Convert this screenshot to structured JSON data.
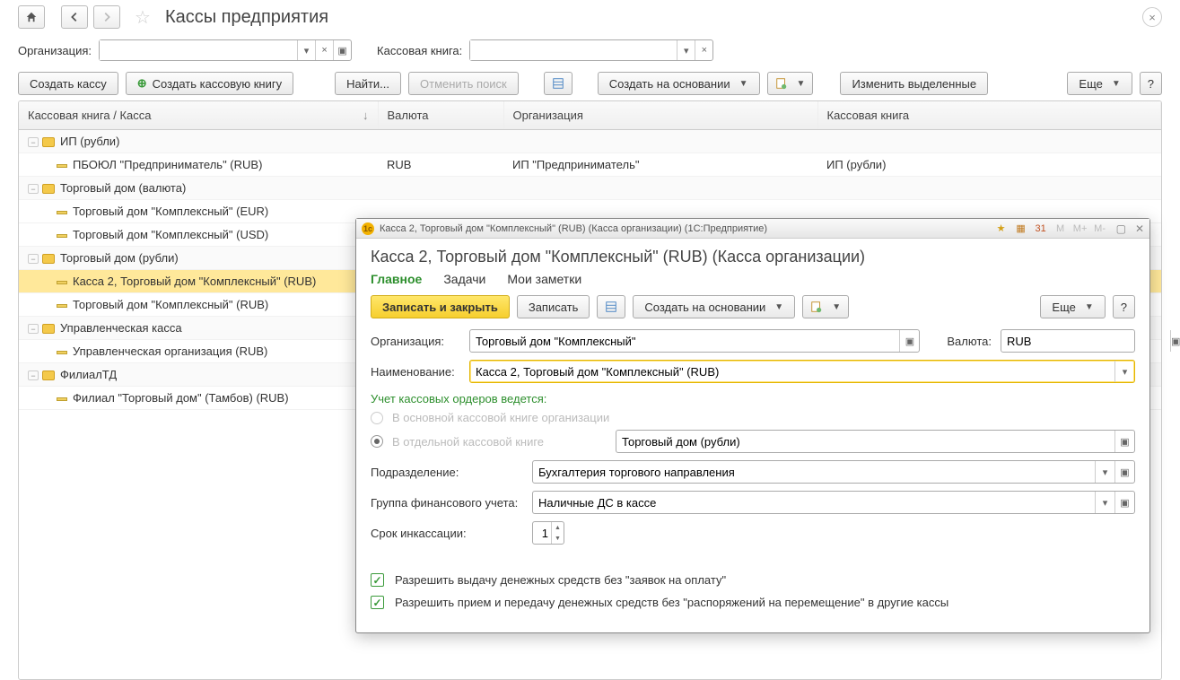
{
  "header": {
    "title": "Кассы предприятия"
  },
  "filters": {
    "org_label": "Организация:",
    "org_value": "",
    "book_label": "Кассовая книга:",
    "book_value": ""
  },
  "toolbar": {
    "create_cash": "Создать кассу",
    "create_book": "Создать кассовую книгу",
    "find": "Найти...",
    "cancel_search": "Отменить поиск",
    "create_based": "Создать на основании",
    "change_selected": "Изменить выделенные",
    "more": "Еще"
  },
  "columns": {
    "c1": "Кассовая книга / Касса",
    "c2": "Валюта",
    "c3": "Организация",
    "c4": "Кассовая книга"
  },
  "rows": [
    {
      "type": "group",
      "name": "ИП (рубли)"
    },
    {
      "type": "leaf",
      "name": "ПБОЮЛ \"Предприниматель\" (RUB)",
      "cur": "RUB",
      "org": "ИП \"Предприниматель\"",
      "book": "ИП (рубли)"
    },
    {
      "type": "group",
      "name": "Торговый дом (валюта)"
    },
    {
      "type": "leaf",
      "name": "Торговый дом \"Комплексный\" (EUR)"
    },
    {
      "type": "leaf",
      "name": "Торговый дом \"Комплексный\" (USD)"
    },
    {
      "type": "group",
      "name": "Торговый дом (рубли)"
    },
    {
      "type": "leaf",
      "name": "Касса 2, Торговый дом \"Комплексный\" (RUB)",
      "sel": true
    },
    {
      "type": "leaf",
      "name": "Торговый дом \"Комплексный\" (RUB)"
    },
    {
      "type": "group",
      "name": "Управленческая касса"
    },
    {
      "type": "leaf",
      "name": "Управленческая организация (RUB)"
    },
    {
      "type": "group",
      "name": "ФилиалТД"
    },
    {
      "type": "leaf",
      "name": "Филиал \"Торговый дом\" (Тамбов) (RUB)"
    }
  ],
  "dialog": {
    "titlebar": "Касса 2, Торговый дом \"Комплексный\" (RUB) (Касса организации)  (1С:Предприятие)",
    "heading": "Касса 2, Торговый дом \"Комплексный\" (RUB) (Касса организации)",
    "tabs": {
      "main": "Главное",
      "tasks": "Задачи",
      "notes": "Мои заметки"
    },
    "actions": {
      "write_close": "Записать и закрыть",
      "write": "Записать",
      "create_based": "Создать на основании",
      "more": "Еще"
    },
    "form": {
      "org_label": "Организация:",
      "org_value": "Торговый дом \"Комплексный\"",
      "cur_label": "Валюта:",
      "cur_value": "RUB",
      "name_label": "Наименование:",
      "name_value": "Касса 2, Торговый дом \"Комплексный\" (RUB)",
      "section_orders": "Учет кассовых ордеров ведется:",
      "radio1": "В основной кассовой книге организации",
      "radio2": "В отдельной кассовой книге",
      "book_value": "Торговый дом (рубли)",
      "dept_label": "Подразделение:",
      "dept_value": "Бухгалтерия торгового направления",
      "fingroup_label": "Группа финансового учета:",
      "fingroup_value": "Наличные ДС в кассе",
      "collection_label": "Срок инкассации:",
      "collection_value": "1",
      "chk1": "Разрешить выдачу денежных средств без \"заявок на оплату\"",
      "chk2": "Разрешить прием и передачу денежных средств без \"распоряжений на перемещение\" в другие кассы"
    }
  }
}
